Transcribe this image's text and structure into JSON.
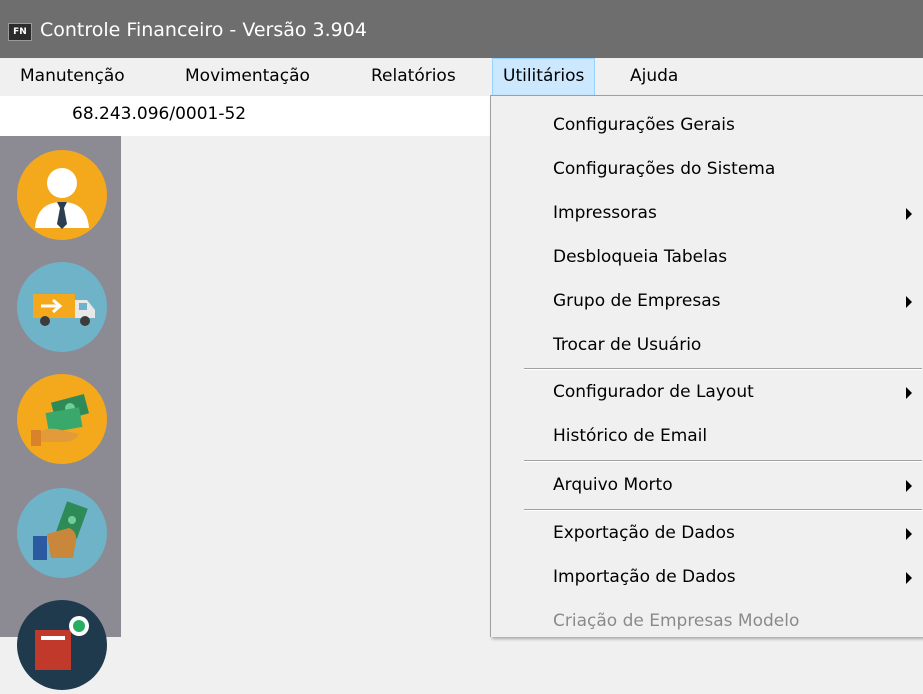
{
  "window": {
    "icon_text": "FN",
    "title": "Controle Financeiro - Versão 3.904"
  },
  "menubar": {
    "items": [
      {
        "label": "Manutenção"
      },
      {
        "label": "Movimentação"
      },
      {
        "label": "Relatórios"
      },
      {
        "label": "Utilitários",
        "active": true
      },
      {
        "label": "Ajuda"
      }
    ]
  },
  "company": {
    "cnpj": "68.243.096/0001-52"
  },
  "sidebar": {
    "icons": [
      {
        "name": "user-profile-icon",
        "color": "#f4a91c"
      },
      {
        "name": "delivery-truck-icon",
        "color": "#6fb3c9"
      },
      {
        "name": "money-payment-icon",
        "color": "#f4a91c"
      },
      {
        "name": "receive-money-icon",
        "color": "#6fb3c9"
      },
      {
        "name": "document-dollar-icon",
        "color": "#1e3a4c"
      }
    ]
  },
  "dropdown": {
    "items": [
      {
        "label": "Configurações Gerais",
        "submenu": false
      },
      {
        "label": "Configurações do Sistema",
        "submenu": false
      },
      {
        "label": "Impressoras",
        "submenu": true
      },
      {
        "label": "Desbloqueia Tabelas",
        "submenu": false
      },
      {
        "label": "Grupo de Empresas",
        "submenu": true
      },
      {
        "label": "Trocar de Usuário",
        "submenu": false
      },
      {
        "label": "Configurador de Layout",
        "submenu": true
      },
      {
        "label": "Histórico de Email",
        "submenu": false
      },
      {
        "label": "Arquivo Morto",
        "submenu": true
      },
      {
        "label": "Exportação de Dados",
        "submenu": true
      },
      {
        "label": "Importação de Dados",
        "submenu": true
      },
      {
        "label": "Criação de Empresas Modelo",
        "submenu": false,
        "disabled": true
      }
    ]
  }
}
